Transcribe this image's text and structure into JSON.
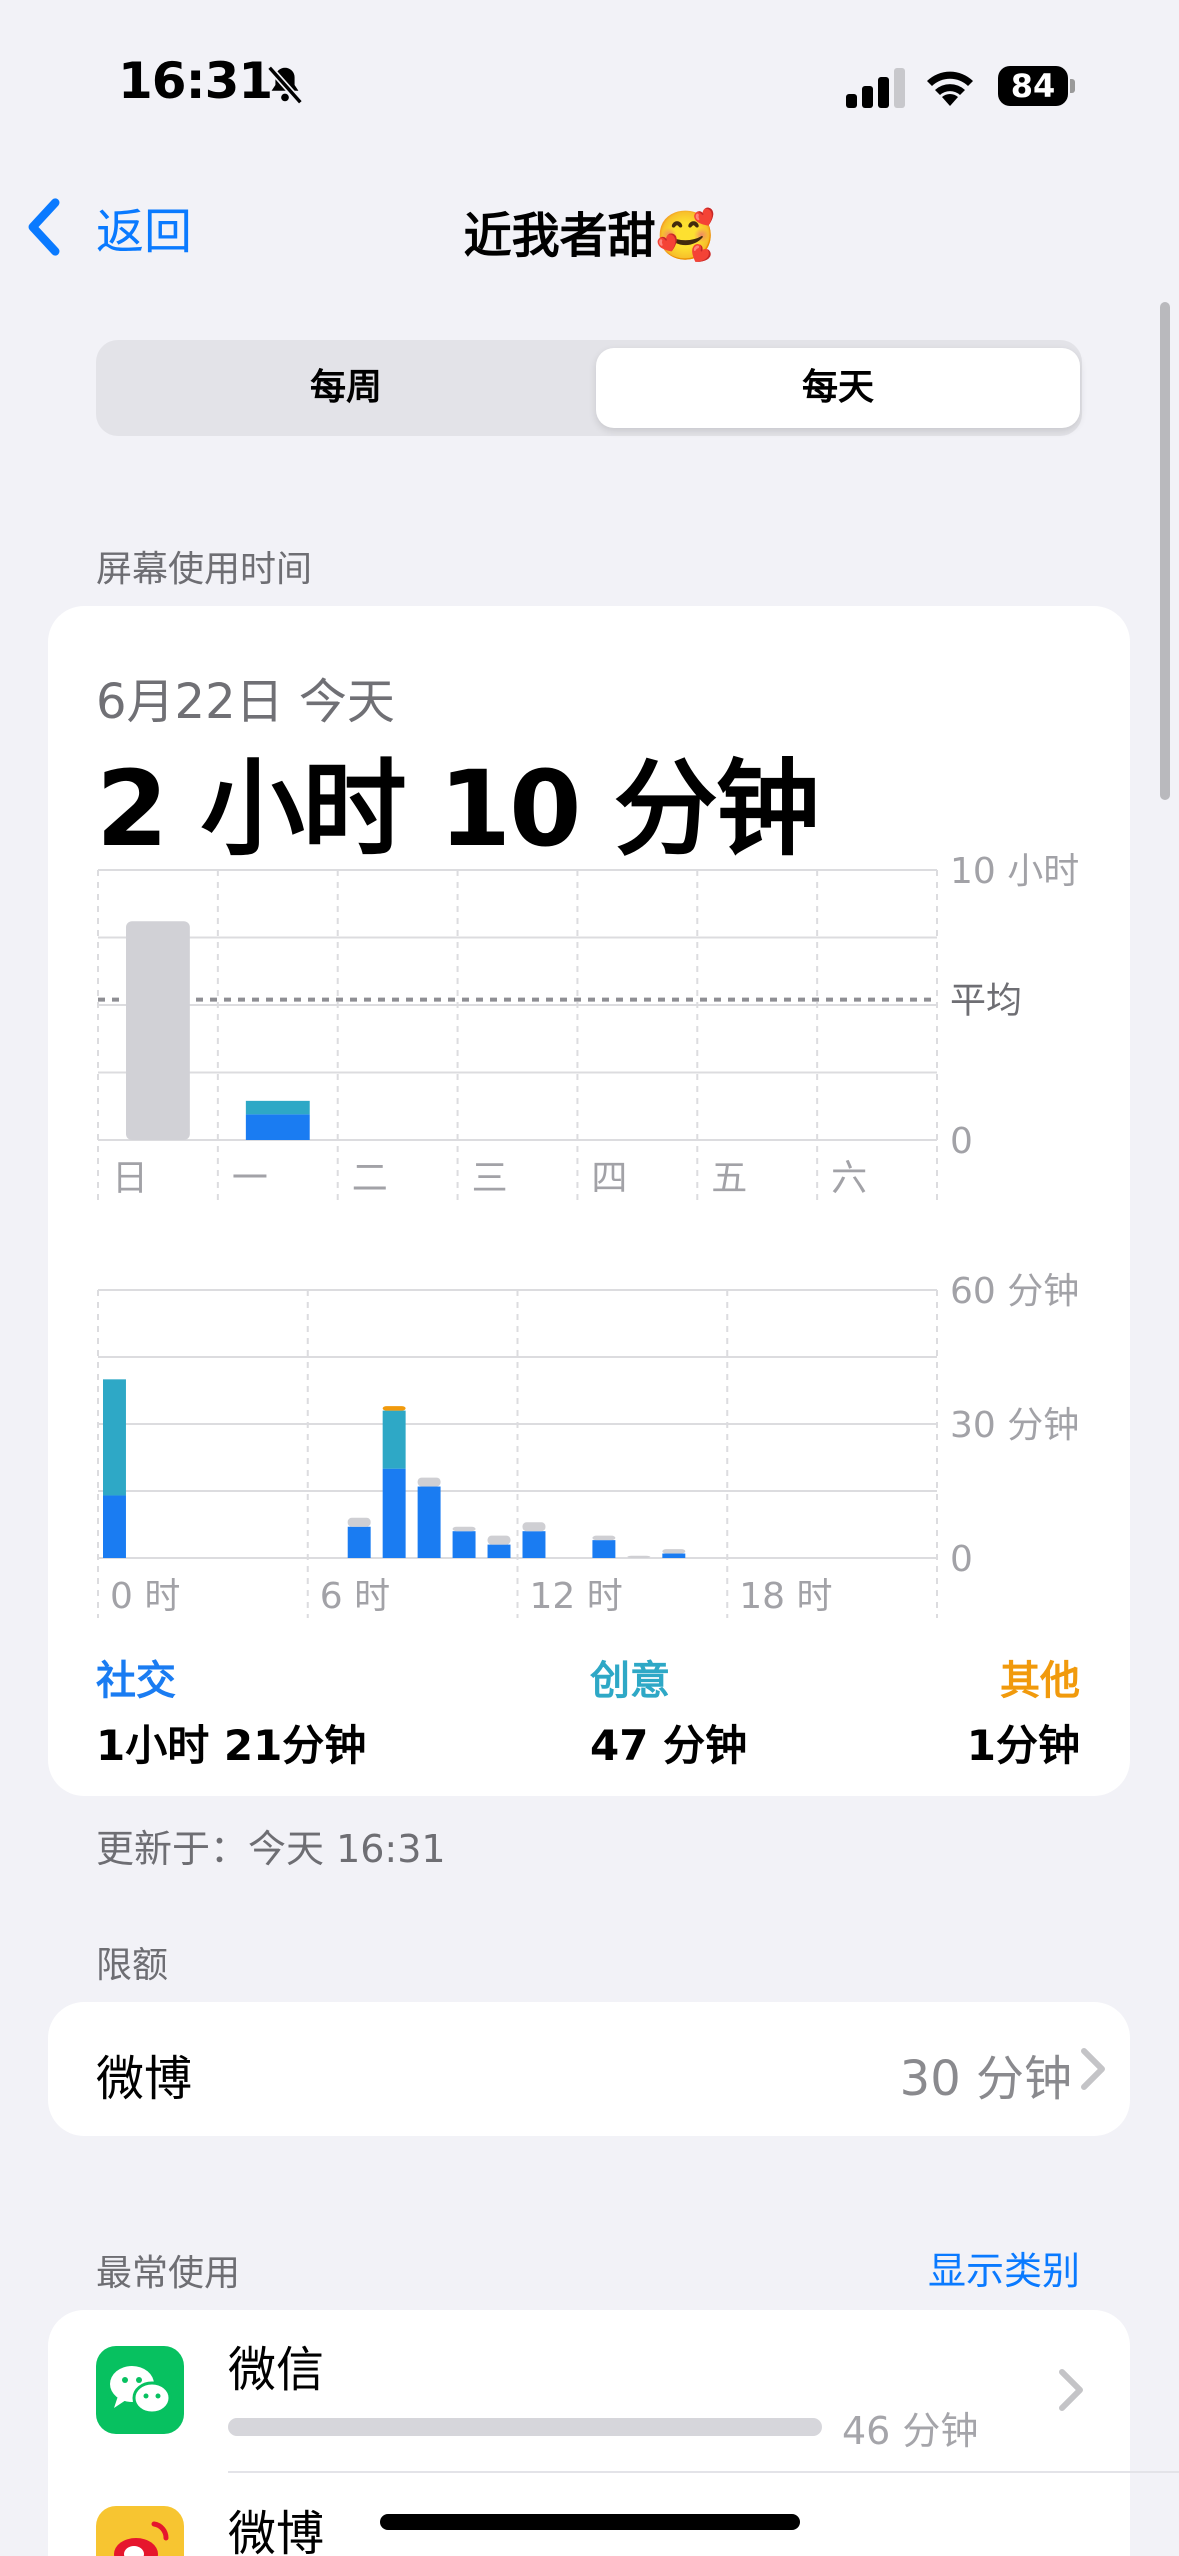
{
  "status": {
    "time": "16:31",
    "battery": "84"
  },
  "nav": {
    "back": "返回",
    "title": "近我者甜🥰"
  },
  "segment": {
    "weekly": "每周",
    "daily": "每天",
    "selected": "每天"
  },
  "screen_time": {
    "section_label": "屏幕使用时间",
    "date": "6月22日 今天",
    "total": "2 小时 10 分钟",
    "updated": "更新于：今天 16:31",
    "categories": [
      {
        "name": "社交",
        "value": "1小时 21分钟",
        "color": "#1a7cf2"
      },
      {
        "name": "创意",
        "value": "47 分钟",
        "color": "#2ea8c6"
      },
      {
        "name": "其他",
        "value": "1分钟",
        "color": "#f19a0c"
      }
    ]
  },
  "chart_data": [
    {
      "type": "bar",
      "categories": [
        "日",
        "一",
        "二",
        "三",
        "四",
        "五",
        "六"
      ],
      "series": [
        {
          "name": "社交",
          "values": [
            0,
            0.95,
            0,
            0,
            0,
            0,
            0
          ]
        },
        {
          "name": "创意",
          "values": [
            0,
            0.5,
            0,
            0,
            0,
            0,
            0
          ]
        },
        {
          "name": "其他",
          "values": [
            8.1,
            0,
            0,
            0,
            0,
            0,
            0
          ]
        }
      ],
      "ylim": [
        0,
        10
      ],
      "y_ticks": [
        "10 小时",
        "平均",
        "0"
      ],
      "average": 5.2,
      "grid": true
    },
    {
      "type": "bar",
      "x": [
        0,
        7,
        8,
        9,
        10,
        11,
        12,
        14,
        15,
        16
      ],
      "x_ticks": [
        "0 时",
        "6 时",
        "12 时",
        "18 时"
      ],
      "series": [
        {
          "name": "社交",
          "values": [
            14,
            7,
            20,
            16,
            6,
            3,
            6,
            4,
            0,
            1
          ]
        },
        {
          "name": "创意",
          "values": [
            26,
            0,
            13,
            0,
            0,
            0,
            0,
            0,
            0,
            0
          ]
        },
        {
          "name": "其他",
          "values": [
            0,
            2,
            1,
            2,
            1,
            2,
            2,
            1,
            0.5,
            1
          ]
        }
      ],
      "ylim": [
        0,
        60
      ],
      "y_ticks": [
        "60 分钟",
        "30 分钟",
        "0"
      ],
      "grid": true
    }
  ],
  "limits": {
    "section_label": "限额",
    "app": "微博",
    "value": "30 分钟"
  },
  "most_used": {
    "section_label": "最常使用",
    "show_categories": "显示类别",
    "apps": [
      {
        "name": "微信",
        "time": "46 分钟",
        "fraction": 1.0
      },
      {
        "name": "微博"
      }
    ]
  }
}
